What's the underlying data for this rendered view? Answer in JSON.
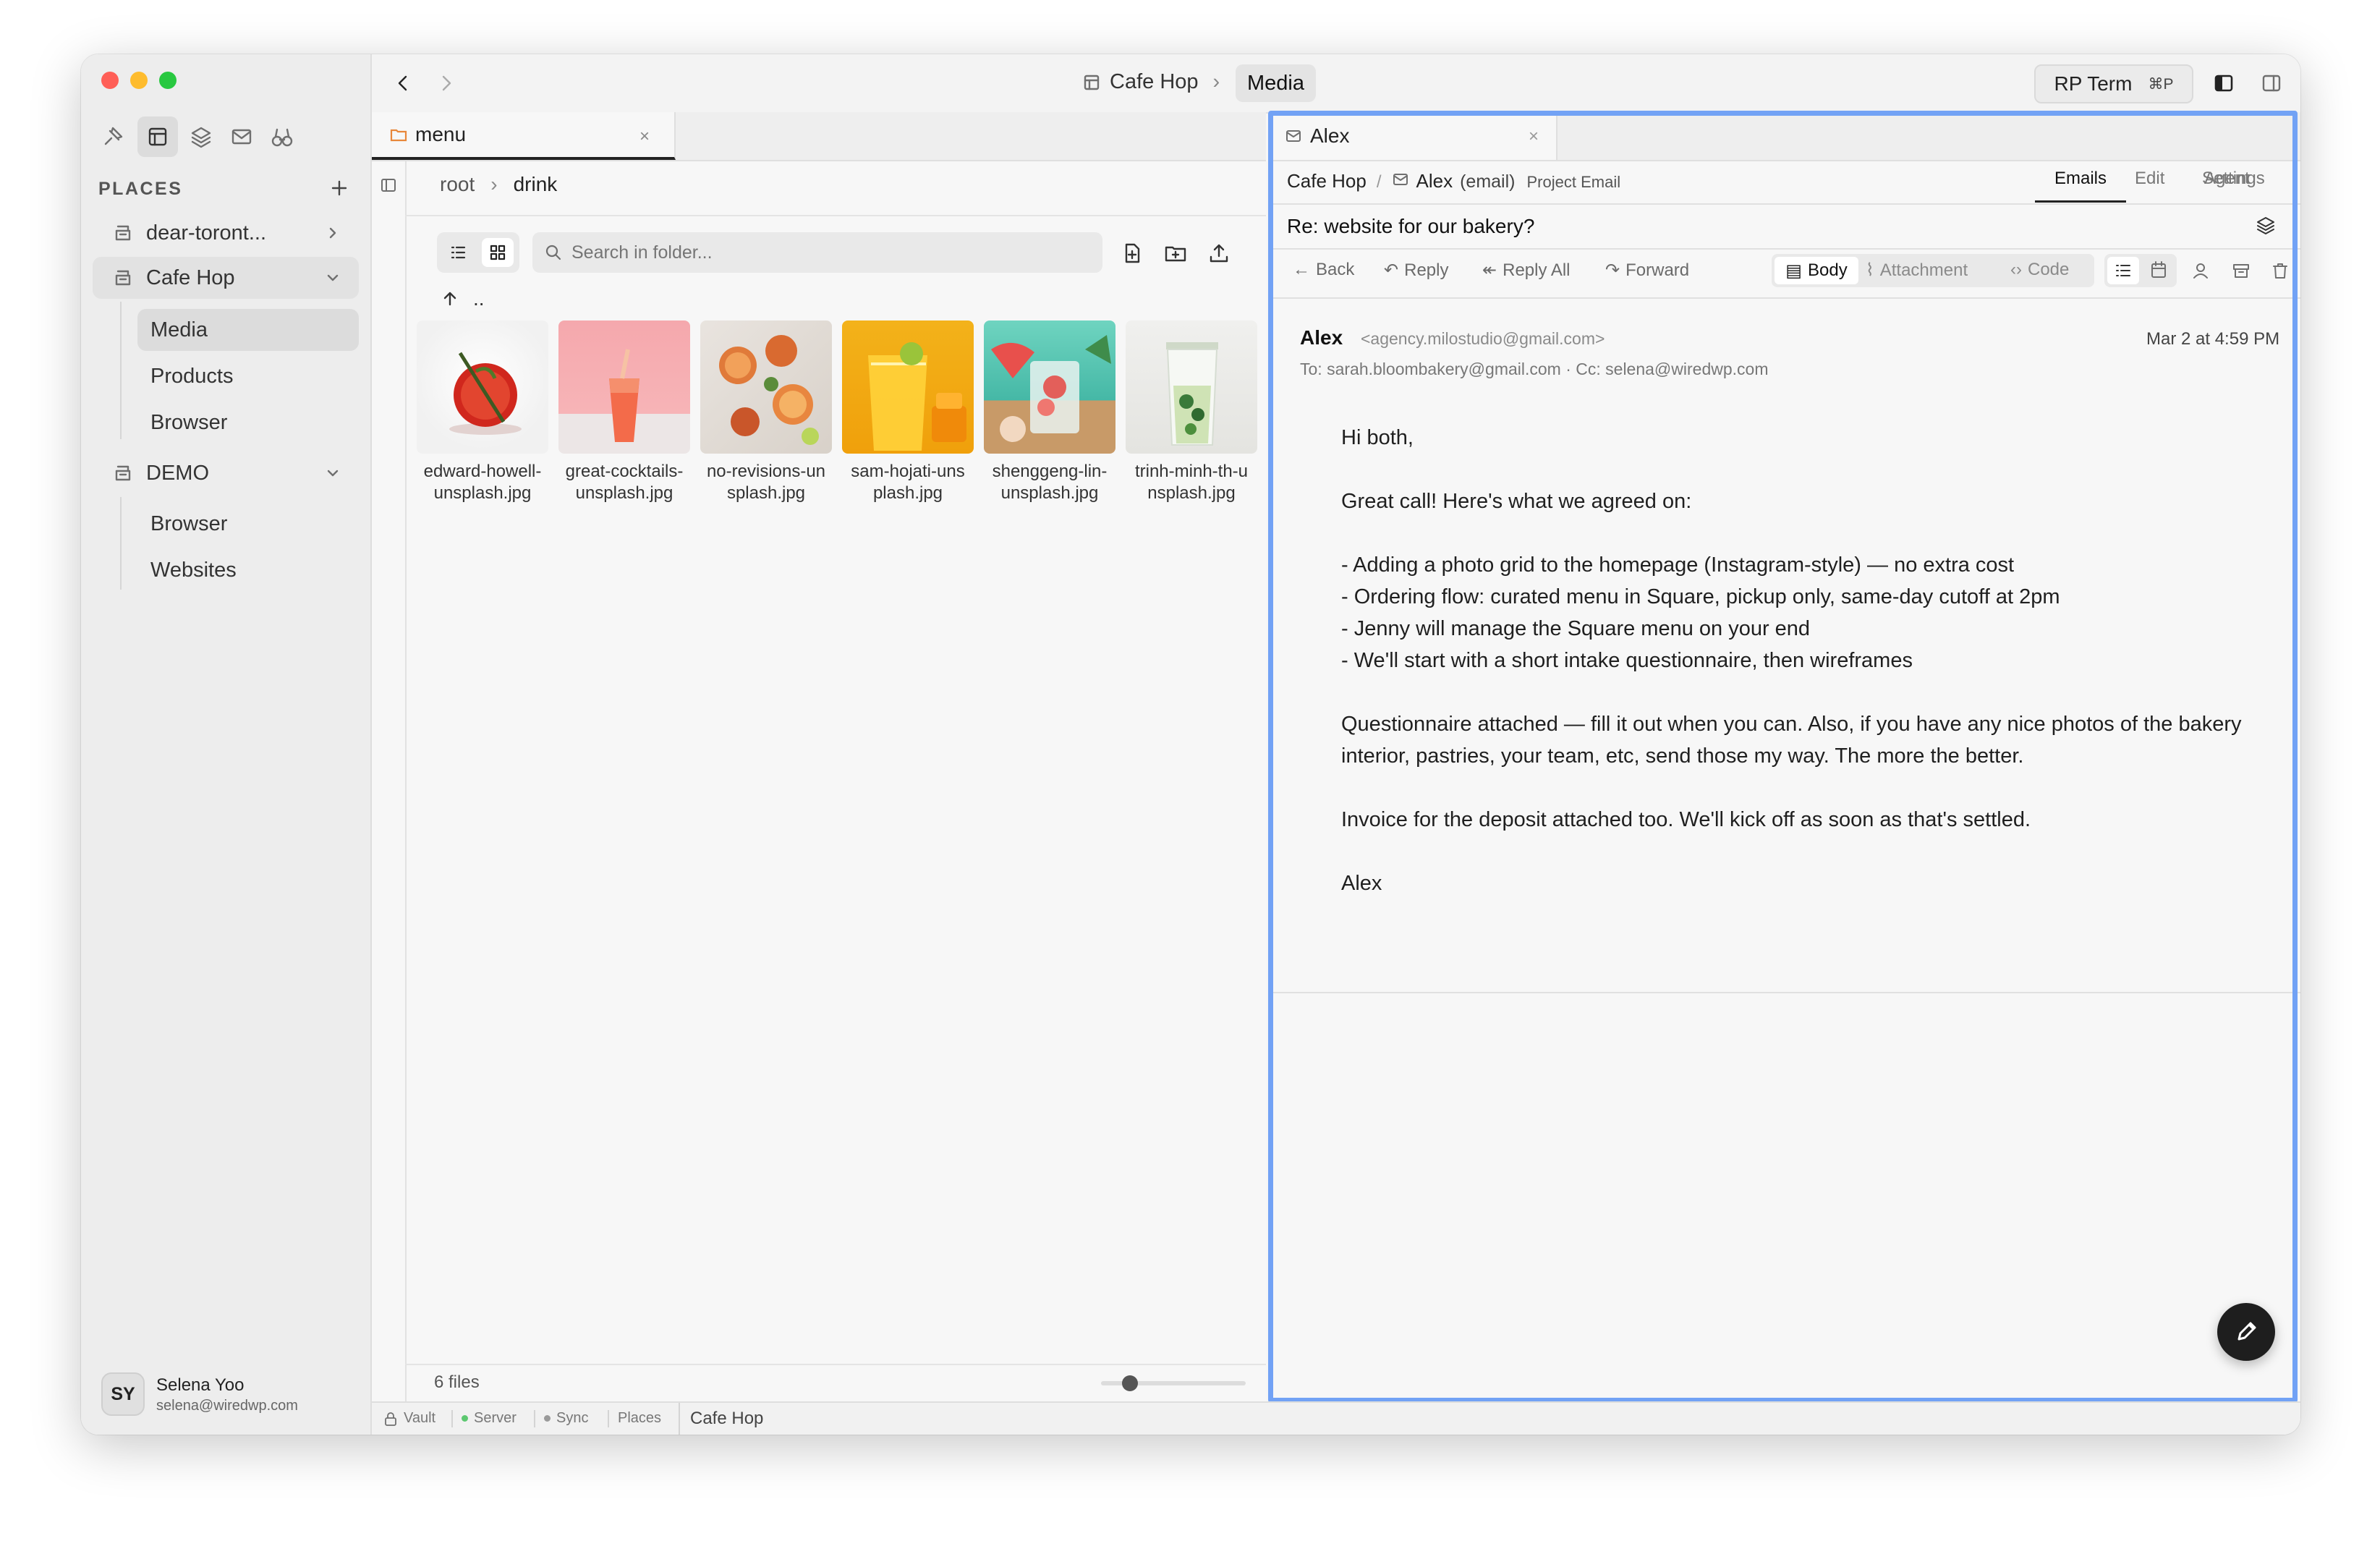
{
  "colors": {
    "accent_frame": "#72a2f5",
    "close_dot": "#ff5f57",
    "minimize_dot": "#febc2e",
    "zoom_dot": "#28c840",
    "server_dot": "#5cc870"
  },
  "sidebar": {
    "places_label": "PLACES",
    "groups": [
      {
        "label": "dear-toront..."
      },
      {
        "label": "Cafe Hop",
        "children": [
          "Media",
          "Products",
          "Browser"
        ]
      },
      {
        "label": "DEMO",
        "children": [
          "Browser",
          "Websites"
        ]
      }
    ],
    "user": {
      "initials": "SY",
      "name": "Selena Yoo",
      "email": "selena@wiredwp.com"
    }
  },
  "titlebar": {
    "breadcrumb_root": "Cafe Hop",
    "breadcrumb_current": "Media",
    "rp_term_label": "RP Term",
    "rp_term_shortcut": "⌘P"
  },
  "files": {
    "tab_label": "menu",
    "path": [
      "root",
      "drink"
    ],
    "search_placeholder": "Search in folder...",
    "parent_label": "..",
    "items": [
      {
        "line1": "edward-howell-",
        "line2": "unsplash.jpg"
      },
      {
        "line1": "great-cocktails-",
        "line2": "unsplash.jpg"
      },
      {
        "line1": "no-revisions-un",
        "line2": "splash.jpg"
      },
      {
        "line1": "sam-hojati-uns",
        "line2": "plash.jpg"
      },
      {
        "line1": "shenggeng-lin-",
        "line2": "unsplash.jpg"
      },
      {
        "line1": "trinh-minh-th-u",
        "line2": "nsplash.jpg"
      }
    ],
    "count": "6 files",
    "zoom_level": 0.2
  },
  "email": {
    "tab_label": "Alex",
    "breadcrumb": {
      "root": "Cafe Hop",
      "sep": "/",
      "sender": "Alex",
      "sender_type": "(email)",
      "project": "Project Email"
    },
    "view_tabs": [
      "Emails",
      "Edit",
      "Agent",
      "Settings"
    ],
    "subject": "Re: website for our bakery?",
    "actions": {
      "back": "Back",
      "reply": "Reply",
      "reply_all": "Reply All",
      "forward": "Forward"
    },
    "segments": {
      "body": "Body",
      "attachment": "Attachment",
      "code": "Code"
    },
    "from_name": "Alex",
    "from_email": "<agency.milostudio@gmail.com>",
    "date": "Mar 2 at 4:59 PM",
    "recipients": "To: sarah.bloombakery@gmail.com · Cc: selena@wiredwp.com",
    "body_lines": [
      "Hi both,",
      "Great call! Here's what we agreed on:",
      "- Adding a photo grid to the homepage (Instagram-style) — no extra cost",
      "- Ordering flow: curated menu in Square, pickup only, same-day cutoff at 2pm",
      "- Jenny will manage the Square menu on your end",
      "- We'll start with a short intake questionnaire, then wireframes",
      "Questionnaire attached — fill it out when you can. Also, if you have any nice photos of the bakery",
      "interior, pastries, your team, etc, send those my way. The more the better.",
      "Invoice for the deposit attached too. We'll kick off as soon as that's settled.",
      "Alex"
    ]
  },
  "statusbar": {
    "vault": "Vault",
    "server": "Server",
    "sync": "Sync",
    "places": "Places",
    "current": "Cafe Hop"
  }
}
